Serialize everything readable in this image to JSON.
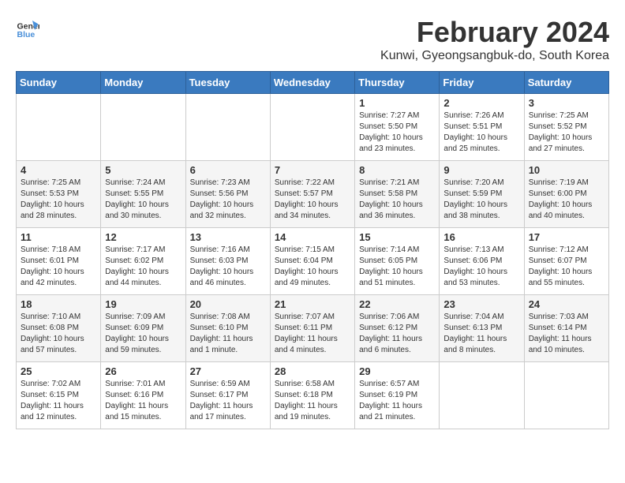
{
  "header": {
    "logo_line1": "General",
    "logo_line2": "Blue",
    "title": "February 2024",
    "subtitle": "Kunwi, Gyeongsangbuk-do, South Korea"
  },
  "days_of_week": [
    "Sunday",
    "Monday",
    "Tuesday",
    "Wednesday",
    "Thursday",
    "Friday",
    "Saturday"
  ],
  "weeks": [
    [
      {
        "day": "",
        "info": ""
      },
      {
        "day": "",
        "info": ""
      },
      {
        "day": "",
        "info": ""
      },
      {
        "day": "",
        "info": ""
      },
      {
        "day": "1",
        "info": "Sunrise: 7:27 AM\nSunset: 5:50 PM\nDaylight: 10 hours\nand 23 minutes."
      },
      {
        "day": "2",
        "info": "Sunrise: 7:26 AM\nSunset: 5:51 PM\nDaylight: 10 hours\nand 25 minutes."
      },
      {
        "day": "3",
        "info": "Sunrise: 7:25 AM\nSunset: 5:52 PM\nDaylight: 10 hours\nand 27 minutes."
      }
    ],
    [
      {
        "day": "4",
        "info": "Sunrise: 7:25 AM\nSunset: 5:53 PM\nDaylight: 10 hours\nand 28 minutes."
      },
      {
        "day": "5",
        "info": "Sunrise: 7:24 AM\nSunset: 5:55 PM\nDaylight: 10 hours\nand 30 minutes."
      },
      {
        "day": "6",
        "info": "Sunrise: 7:23 AM\nSunset: 5:56 PM\nDaylight: 10 hours\nand 32 minutes."
      },
      {
        "day": "7",
        "info": "Sunrise: 7:22 AM\nSunset: 5:57 PM\nDaylight: 10 hours\nand 34 minutes."
      },
      {
        "day": "8",
        "info": "Sunrise: 7:21 AM\nSunset: 5:58 PM\nDaylight: 10 hours\nand 36 minutes."
      },
      {
        "day": "9",
        "info": "Sunrise: 7:20 AM\nSunset: 5:59 PM\nDaylight: 10 hours\nand 38 minutes."
      },
      {
        "day": "10",
        "info": "Sunrise: 7:19 AM\nSunset: 6:00 PM\nDaylight: 10 hours\nand 40 minutes."
      }
    ],
    [
      {
        "day": "11",
        "info": "Sunrise: 7:18 AM\nSunset: 6:01 PM\nDaylight: 10 hours\nand 42 minutes."
      },
      {
        "day": "12",
        "info": "Sunrise: 7:17 AM\nSunset: 6:02 PM\nDaylight: 10 hours\nand 44 minutes."
      },
      {
        "day": "13",
        "info": "Sunrise: 7:16 AM\nSunset: 6:03 PM\nDaylight: 10 hours\nand 46 minutes."
      },
      {
        "day": "14",
        "info": "Sunrise: 7:15 AM\nSunset: 6:04 PM\nDaylight: 10 hours\nand 49 minutes."
      },
      {
        "day": "15",
        "info": "Sunrise: 7:14 AM\nSunset: 6:05 PM\nDaylight: 10 hours\nand 51 minutes."
      },
      {
        "day": "16",
        "info": "Sunrise: 7:13 AM\nSunset: 6:06 PM\nDaylight: 10 hours\nand 53 minutes."
      },
      {
        "day": "17",
        "info": "Sunrise: 7:12 AM\nSunset: 6:07 PM\nDaylight: 10 hours\nand 55 minutes."
      }
    ],
    [
      {
        "day": "18",
        "info": "Sunrise: 7:10 AM\nSunset: 6:08 PM\nDaylight: 10 hours\nand 57 minutes."
      },
      {
        "day": "19",
        "info": "Sunrise: 7:09 AM\nSunset: 6:09 PM\nDaylight: 10 hours\nand 59 minutes."
      },
      {
        "day": "20",
        "info": "Sunrise: 7:08 AM\nSunset: 6:10 PM\nDaylight: 11 hours\nand 1 minute."
      },
      {
        "day": "21",
        "info": "Sunrise: 7:07 AM\nSunset: 6:11 PM\nDaylight: 11 hours\nand 4 minutes."
      },
      {
        "day": "22",
        "info": "Sunrise: 7:06 AM\nSunset: 6:12 PM\nDaylight: 11 hours\nand 6 minutes."
      },
      {
        "day": "23",
        "info": "Sunrise: 7:04 AM\nSunset: 6:13 PM\nDaylight: 11 hours\nand 8 minutes."
      },
      {
        "day": "24",
        "info": "Sunrise: 7:03 AM\nSunset: 6:14 PM\nDaylight: 11 hours\nand 10 minutes."
      }
    ],
    [
      {
        "day": "25",
        "info": "Sunrise: 7:02 AM\nSunset: 6:15 PM\nDaylight: 11 hours\nand 12 minutes."
      },
      {
        "day": "26",
        "info": "Sunrise: 7:01 AM\nSunset: 6:16 PM\nDaylight: 11 hours\nand 15 minutes."
      },
      {
        "day": "27",
        "info": "Sunrise: 6:59 AM\nSunset: 6:17 PM\nDaylight: 11 hours\nand 17 minutes."
      },
      {
        "day": "28",
        "info": "Sunrise: 6:58 AM\nSunset: 6:18 PM\nDaylight: 11 hours\nand 19 minutes."
      },
      {
        "day": "29",
        "info": "Sunrise: 6:57 AM\nSunset: 6:19 PM\nDaylight: 11 hours\nand 21 minutes."
      },
      {
        "day": "",
        "info": ""
      },
      {
        "day": "",
        "info": ""
      }
    ]
  ]
}
